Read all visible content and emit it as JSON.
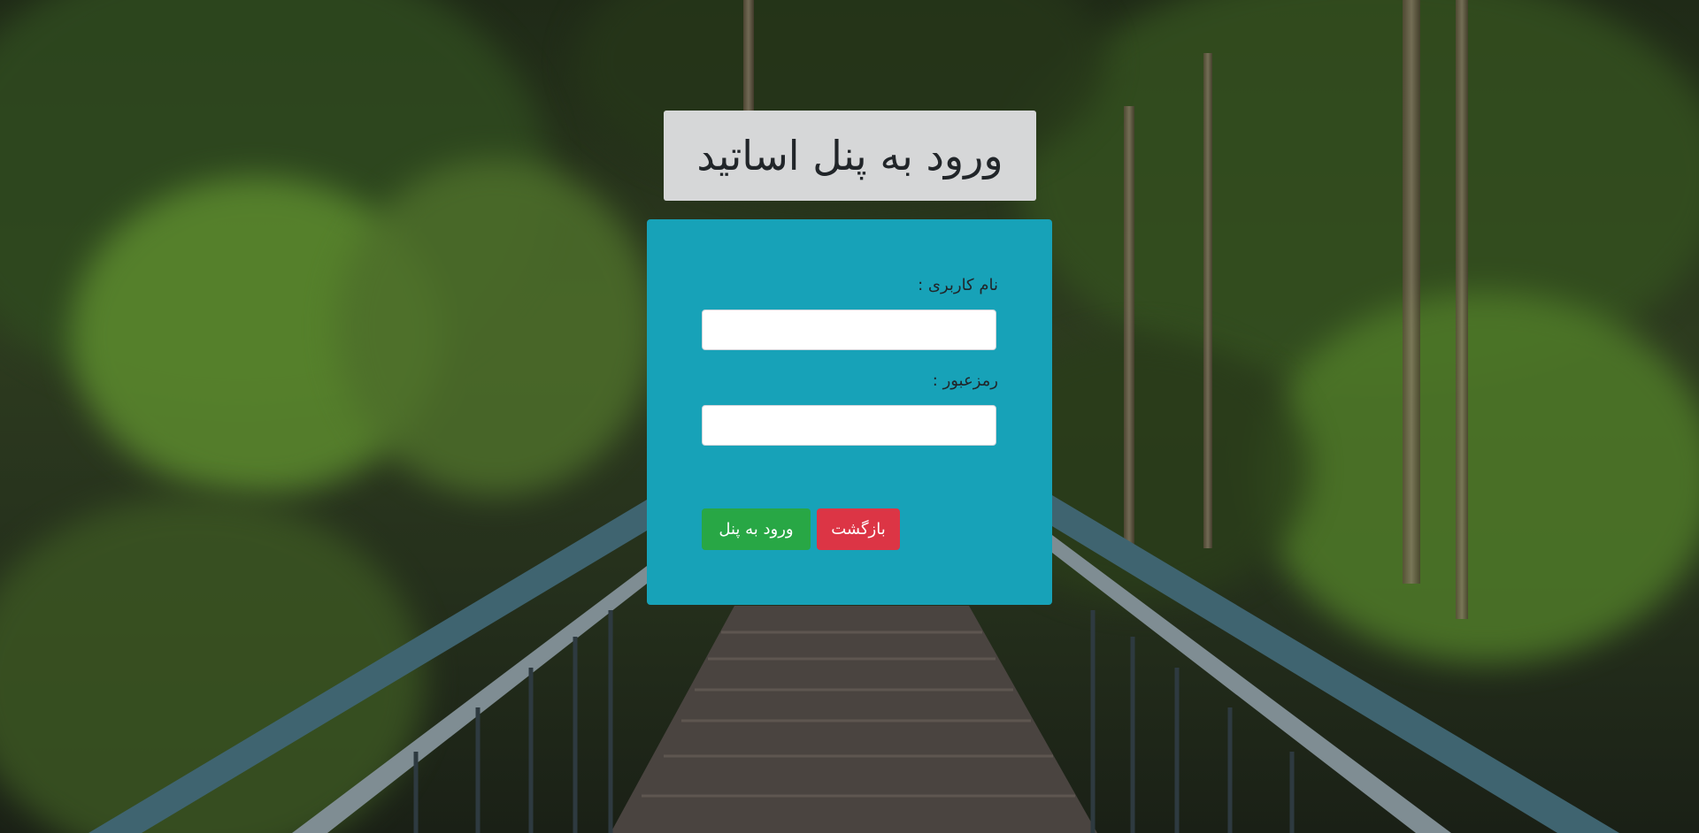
{
  "page": {
    "title": "ورود به پنل اساتید"
  },
  "form": {
    "username_label": "نام کاربری :",
    "username_value": "",
    "password_label": "رمزعبور :",
    "password_value": "",
    "login_button": "ورود به پنل",
    "back_button": "بازگشت"
  },
  "colors": {
    "panel": "#17a2b8",
    "title_box": "#d6d7d8",
    "login_button": "#28a745",
    "back_button": "#dc3545"
  },
  "background": {
    "description_icon": "forest-bridge-photo"
  }
}
